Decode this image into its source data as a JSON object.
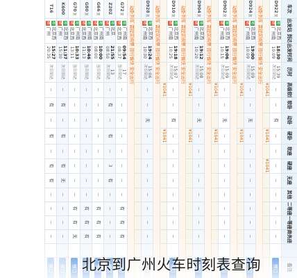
{
  "header": {
    "train": "车次",
    "stations": "出发站 到达站",
    "times": "出发时间 到达时间",
    "duration": "历时",
    "business": "商务座",
    "first": "一等座",
    "second": "二等座",
    "premium_sleeper": "高级软卧",
    "soft_sleeper": "软卧",
    "move_sleeper": "动卧",
    "hard_sleeper": "硬卧",
    "soft_seat": "软座",
    "hard_seat": "硬座",
    "no_seat": "无座",
    "other": "其他",
    "note": "备注"
  },
  "rows": [
    {
      "train": "D922",
      "tag": "复",
      "from": "北京西",
      "to": "广州南",
      "dep": "18:30",
      "arr": "10:09",
      "dur": "15:39",
      "dur2": "次日到达",
      "premium_sleeper": "--",
      "soft_sleeper": "--",
      "move_sleeper": "有",
      "hard_sleeper": "--",
      "soft_seat": "--",
      "hard_seat": "--",
      "no_seat": "--",
      "other": "--",
      "second": "--",
      "first": "--",
      "business": "--",
      "prices": [
        "¥1041",
        "",
        "",
        "¥1041",
        "",
        "¥1041"
      ],
      "button": "预订"
    },
    {
      "train": "D924",
      "tag": "复",
      "from": "北京西",
      "to": "广州南",
      "dep": "19:00",
      "arr": "10:09",
      "dur": "15:09",
      "dur2": "次日到达",
      "premium_sleeper": "--",
      "soft_sleeper": "--",
      "move_sleeper": "无",
      "hard_sleeper": "--",
      "soft_seat": "--",
      "hard_seat": "--",
      "no_seat": "--",
      "other": "--",
      "second": "--",
      "first": "--",
      "business": "--",
      "prices": [
        "¥1041",
        "",
        "",
        "¥1041",
        "",
        ""
      ],
      "button": "预订"
    },
    {
      "train": "D902",
      "tag": "复",
      "from": "北京西",
      "to": "广州南",
      "dep": "19:06",
      "arr": "10:15",
      "dur": "15:09",
      "dur2": "次日到达",
      "premium_sleeper": "--",
      "soft_sleeper": "--",
      "move_sleeper": "无",
      "hard_sleeper": "--",
      "soft_seat": "--",
      "hard_seat": "--",
      "no_seat": "--",
      "other": "--",
      "second": "--",
      "first": "--",
      "business": "--",
      "prices": [
        "¥1041",
        "",
        "",
        "¥1041",
        "",
        ""
      ],
      "button": "预订"
    },
    {
      "train": "D904",
      "tag": "复",
      "from": "北京西",
      "to": "广州南",
      "dep": "19:12",
      "arr": "10:20",
      "dur": "15:08",
      "dur2": "次日到达",
      "premium_sleeper": "--",
      "soft_sleeper": "--",
      "move_sleeper": "无",
      "hard_sleeper": "--",
      "soft_seat": "--",
      "hard_seat": "--",
      "no_seat": "--",
      "other": "--",
      "second": "--",
      "first": "--",
      "business": "--",
      "prices": [
        "¥1041",
        "",
        "",
        "¥1041",
        "",
        ""
      ],
      "button": "预订"
    },
    {
      "train": "D910",
      "tag": "复",
      "from": "北京西",
      "to": "广州南",
      "dep": "19:18",
      "arr": "10:25",
      "dur": "15:07",
      "dur2": "次日到达",
      "premium_sleeper": "--",
      "soft_sleeper": "--",
      "move_sleeper": "有",
      "hard_sleeper": "--",
      "soft_seat": "--",
      "hard_seat": "--",
      "no_seat": "--",
      "other": "--",
      "second": "--",
      "first": "--",
      "business": "--",
      "prices": [
        "¥1041",
        "",
        "",
        "¥1041",
        "",
        ""
      ],
      "button": "预订"
    },
    {
      "train": "D928",
      "tag": "复",
      "from": "北京西",
      "to": "广州南",
      "dep": "19:24",
      "arr": "10:30",
      "dur": "15:06",
      "dur2": "次日到达",
      "premium_sleeper": "--",
      "soft_sleeper": "--",
      "move_sleeper": "无",
      "hard_sleeper": "--",
      "soft_seat": "--",
      "hard_seat": "--",
      "no_seat": "--",
      "other": "--",
      "second": "--",
      "first": "--",
      "business": "--",
      "prices": [
        "",
        "",
        "",
        "",
        "",
        ""
      ],
      "button": "预订",
      "disabled": true
    },
    {
      "train": "G72",
      "tag": "复",
      "from": "广州南",
      "to": "北京西",
      "dep": "09:54",
      "arr": "08:37",
      "dur": "17",
      "dur2": "当日到达",
      "premium_sleeper": "--",
      "soft_sleeper": "--",
      "move_sleeper": "--",
      "hard_sleeper": "--",
      "soft_seat": "--",
      "hard_seat": "--",
      "no_seat": "--",
      "other": "--",
      "second": "有",
      "first": "有",
      "business": "有",
      "prices": null,
      "button": "预订"
    },
    {
      "train": "Z202",
      "tag": "",
      "from": "北京",
      "to": "广州",
      "dep": "21:55",
      "arr": "08:50",
      "dur": "13",
      "dur2": "次日到达",
      "premium_sleeper": "--",
      "soft_sleeper": "有",
      "move_sleeper": "--",
      "hard_sleeper": "有",
      "soft_seat": "--",
      "hard_seat": "3",
      "no_seat": "有",
      "other": "--",
      "second": "--",
      "first": "--",
      "business": "--",
      "prices": null,
      "button": "预订"
    },
    {
      "train": "G66",
      "tag": "复",
      "from": "广州南",
      "to": "北京西",
      "dep": "10:00",
      "arr": "08:00",
      "dur": "",
      "dur2": "当日到达",
      "premium_sleeper": "--",
      "soft_sleeper": "--",
      "move_sleeper": "--",
      "hard_sleeper": "--",
      "soft_seat": "--",
      "hard_seat": "--",
      "no_seat": "--",
      "other": "--",
      "second": "有",
      "first": "有",
      "business": "有",
      "prices": null,
      "button": "预订"
    },
    {
      "train": "G80",
      "tag": "复",
      "from": "广州南",
      "to": "北京西",
      "dep": "10:46",
      "arr": "11:13",
      "dur": "",
      "dur2": "当日到达",
      "premium_sleeper": "--",
      "soft_sleeper": "--",
      "move_sleeper": "--",
      "hard_sleeper": "--",
      "soft_seat": "--",
      "hard_seat": "--",
      "no_seat": "--",
      "other": "--",
      "second": "有",
      "first": "有",
      "business": "有",
      "prices": null,
      "button": "预订"
    },
    {
      "train": "G70",
      "tag": "复",
      "from": "广州南",
      "to": "北京西",
      "dep": "10:33",
      "arr": "13:11",
      "dur": "",
      "dur2": "当日到达",
      "premium_sleeper": "--",
      "soft_sleeper": "--",
      "move_sleeper": "--",
      "hard_sleeper": "--",
      "soft_seat": "--",
      "hard_seat": "--",
      "no_seat": "--",
      "other": "--",
      "second": "有",
      "first": "有",
      "business": "无",
      "prices": null,
      "button": "预订"
    },
    {
      "train": "K600",
      "tag": "",
      "from": "北京西",
      "to": "广州",
      "dep": "11:37",
      "arr": "15:30",
      "dur": "",
      "dur2": "次日到达",
      "premium_sleeper": "--",
      "soft_sleeper": "有",
      "move_sleeper": "--",
      "hard_sleeper": "有",
      "soft_seat": "--",
      "hard_seat": "有",
      "no_seat": "无",
      "other": "--",
      "second": "--",
      "first": "--",
      "business": "--",
      "prices": null,
      "button": "预订"
    },
    {
      "train": "T16",
      "tag": "",
      "from": "北京西",
      "to": "广州",
      "dep": "15:27",
      "arr": "20:35",
      "dur": "",
      "dur2": "次日到达",
      "premium_sleeper": "--",
      "soft_sleeper": "有",
      "move_sleeper": "--",
      "hard_sleeper": "有",
      "soft_seat": "--",
      "hard_seat": "有",
      "no_seat": "有",
      "other": "--",
      "second": "--",
      "first": "--",
      "business": "--",
      "prices": null,
      "button": "预订"
    }
  ],
  "dynamic_note": "动卧列车 需提前购票 旅行愉快 安全出行",
  "overlay_title": "北京到广州火车时刻表查询"
}
